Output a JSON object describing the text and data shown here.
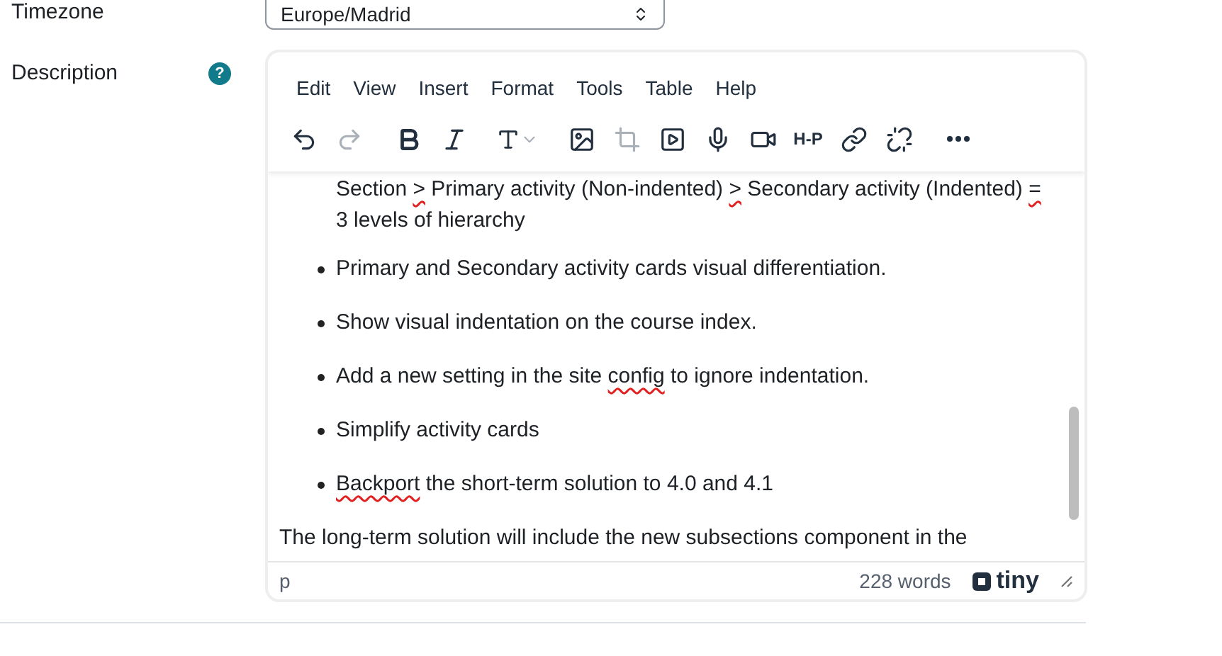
{
  "timezone": {
    "label": "Timezone",
    "value": "Europe/Madrid"
  },
  "description": {
    "label": "Description",
    "help": "?",
    "editor": {
      "menu": [
        "Edit",
        "View",
        "Insert",
        "Format",
        "Tools",
        "Table",
        "Help"
      ],
      "toolbar": [
        {
          "kind": "undo",
          "disabled": false
        },
        {
          "kind": "redo",
          "disabled": true
        },
        {
          "kind": "bold",
          "disabled": false
        },
        {
          "kind": "italic",
          "disabled": false
        },
        {
          "kind": "text-format",
          "disabled": false
        },
        {
          "kind": "image",
          "disabled": false
        },
        {
          "kind": "crop",
          "disabled": true
        },
        {
          "kind": "media",
          "disabled": false
        },
        {
          "kind": "microphone",
          "disabled": false
        },
        {
          "kind": "video",
          "disabled": false
        },
        {
          "kind": "h5p",
          "label": "H-P",
          "disabled": false
        },
        {
          "kind": "link",
          "disabled": false
        },
        {
          "kind": "unlink",
          "disabled": false
        },
        {
          "kind": "more",
          "disabled": false
        }
      ],
      "content": [
        {
          "kind": "continuation",
          "segments": [
            {
              "text": "Section ",
              "misspelled": false
            },
            {
              "text": ">",
              "misspelled": true
            },
            {
              "text": " Primary activity (Non-indented) ",
              "misspelled": false
            },
            {
              "text": ">",
              "misspelled": true
            },
            {
              "text": " Secondary activity (Indented) ",
              "misspelled": false
            },
            {
              "text": "=",
              "misspelled": true
            },
            {
              "text": " 3 levels of hierarchy",
              "misspelled": false
            }
          ]
        },
        {
          "kind": "bullet",
          "segments": [
            {
              "text": "Primary and Secondary activity cards visual differentiation.",
              "misspelled": false
            }
          ]
        },
        {
          "kind": "bullet",
          "segments": [
            {
              "text": "Show visual indentation on the course index.",
              "misspelled": false
            }
          ]
        },
        {
          "kind": "bullet",
          "segments": [
            {
              "text": "Add a new setting in the site ",
              "misspelled": false
            },
            {
              "text": "config",
              "misspelled": true
            },
            {
              "text": " to ignore indentation.",
              "misspelled": false
            }
          ]
        },
        {
          "kind": "bullet",
          "segments": [
            {
              "text": "Simplify activity cards",
              "misspelled": false
            }
          ]
        },
        {
          "kind": "bullet",
          "segments": [
            {
              "text": "Backport",
              "misspelled": true
            },
            {
              "text": " the short-term solution to 4.0 and 4.1",
              "misspelled": false
            }
          ]
        },
        {
          "kind": "paragraph",
          "segments": [
            {
              "text": "The long-term solution will include the new subsections component in the",
              "misspelled": false
            }
          ]
        }
      ],
      "status": {
        "path": "p",
        "word_count": "228 words",
        "brand": "tiny"
      }
    }
  }
}
